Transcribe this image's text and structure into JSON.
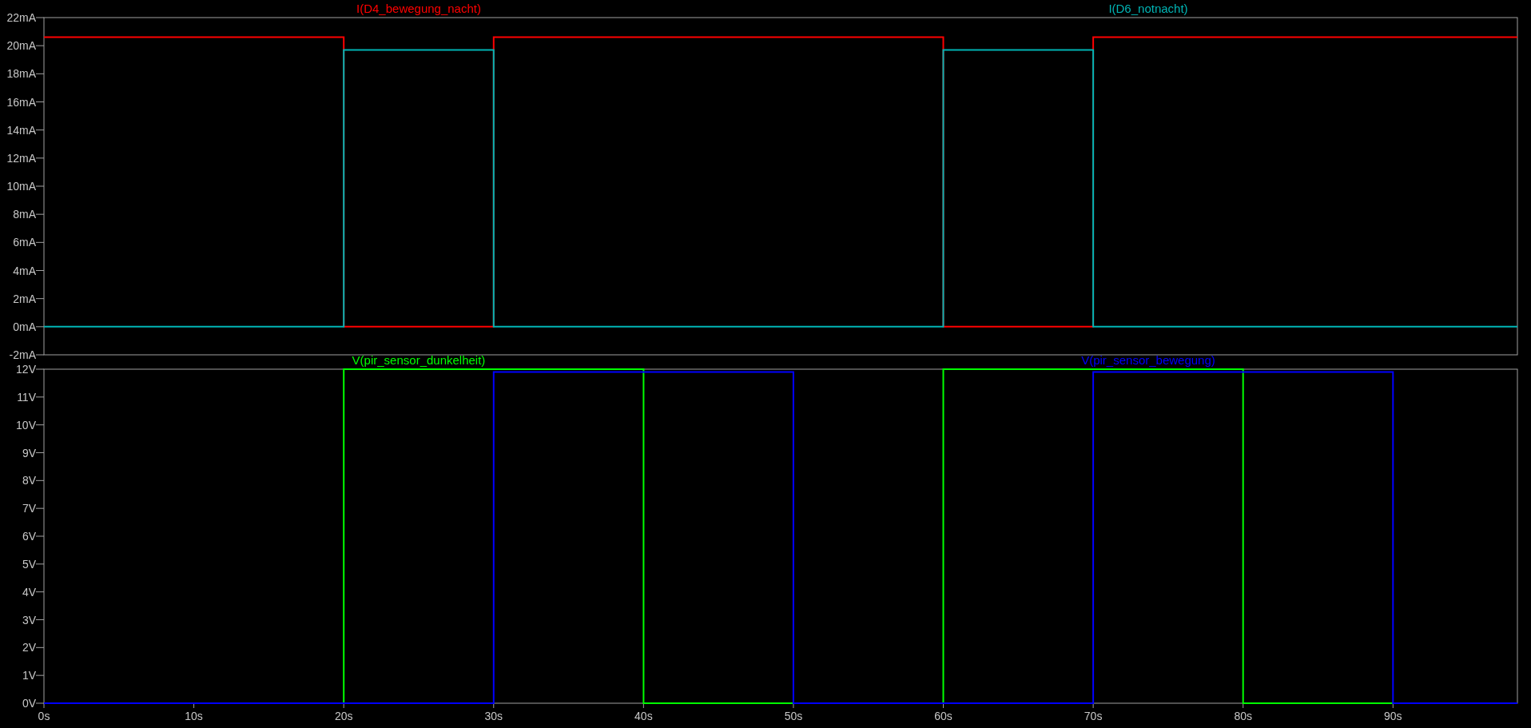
{
  "plots": [
    {
      "chart_data": {
        "type": "line",
        "xlim": [
          0,
          98.3
        ],
        "ylim": [
          -2,
          22
        ],
        "yticks": [
          {
            "value": 22,
            "label": "22mA"
          },
          {
            "value": 20,
            "label": "20mA"
          },
          {
            "value": 18,
            "label": "18mA"
          },
          {
            "value": 16,
            "label": "16mA"
          },
          {
            "value": 14,
            "label": "14mA"
          },
          {
            "value": 12,
            "label": "12mA"
          },
          {
            "value": 10,
            "label": "10mA"
          },
          {
            "value": 8,
            "label": "8mA"
          },
          {
            "value": 6,
            "label": "6mA"
          },
          {
            "value": 4,
            "label": "4mA"
          },
          {
            "value": 2,
            "label": "2mA"
          },
          {
            "value": 0,
            "label": "0mA"
          },
          {
            "value": -2,
            "label": "-2mA"
          }
        ],
        "x": [
          0,
          20,
          20,
          30,
          30,
          60,
          60,
          70,
          70,
          98.3
        ],
        "series": [
          {
            "name": "I(D4_bewegung_nacht)",
            "color": "#ff0000",
            "values": [
              20.6,
              20.6,
              0,
              0,
              20.6,
              20.6,
              0,
              0,
              20.6,
              20.6
            ]
          },
          {
            "name": "I(D6_notnacht)",
            "color": "#00b4b4",
            "values": [
              0,
              0,
              19.7,
              19.7,
              0,
              0,
              19.7,
              19.7,
              0,
              0
            ]
          }
        ]
      }
    },
    {
      "chart_data": {
        "type": "line",
        "xlim": [
          0,
          98.3
        ],
        "ylim": [
          0,
          12
        ],
        "xticks": [
          {
            "value": 0,
            "label": "0s"
          },
          {
            "value": 10,
            "label": "10s"
          },
          {
            "value": 20,
            "label": "20s"
          },
          {
            "value": 30,
            "label": "30s"
          },
          {
            "value": 40,
            "label": "40s"
          },
          {
            "value": 50,
            "label": "50s"
          },
          {
            "value": 60,
            "label": "60s"
          },
          {
            "value": 70,
            "label": "70s"
          },
          {
            "value": 80,
            "label": "80s"
          },
          {
            "value": 90,
            "label": "90s"
          }
        ],
        "yticks": [
          {
            "value": 12,
            "label": "12V"
          },
          {
            "value": 11,
            "label": "11V"
          },
          {
            "value": 10,
            "label": "10V"
          },
          {
            "value": 9,
            "label": "9V"
          },
          {
            "value": 8,
            "label": "8V"
          },
          {
            "value": 7,
            "label": "7V"
          },
          {
            "value": 6,
            "label": "6V"
          },
          {
            "value": 5,
            "label": "5V"
          },
          {
            "value": 4,
            "label": "4V"
          },
          {
            "value": 3,
            "label": "3V"
          },
          {
            "value": 2,
            "label": "2V"
          },
          {
            "value": 1,
            "label": "1V"
          },
          {
            "value": 0,
            "label": "0V"
          }
        ],
        "x": [
          0,
          20,
          20,
          30,
          30,
          40,
          40,
          50,
          50,
          60,
          60,
          70,
          70,
          80,
          80,
          90,
          90,
          98.3
        ],
        "series": [
          {
            "name": "V(pir_sensor_dunkelheit)",
            "color": "#00ff00",
            "values": [
              0,
              0,
              12,
              12,
              12,
              12,
              0,
              0,
              0,
              0,
              12,
              12,
              12,
              12,
              0,
              0,
              0,
              0
            ]
          },
          {
            "name": "V(pir_sensor_bewegung)",
            "color": "#0000ff",
            "values": [
              0,
              0,
              0,
              0,
              11.9,
              11.9,
              11.9,
              11.9,
              0,
              0,
              0,
              0,
              11.9,
              11.9,
              11.9,
              11.9,
              0,
              0
            ]
          }
        ]
      }
    }
  ]
}
